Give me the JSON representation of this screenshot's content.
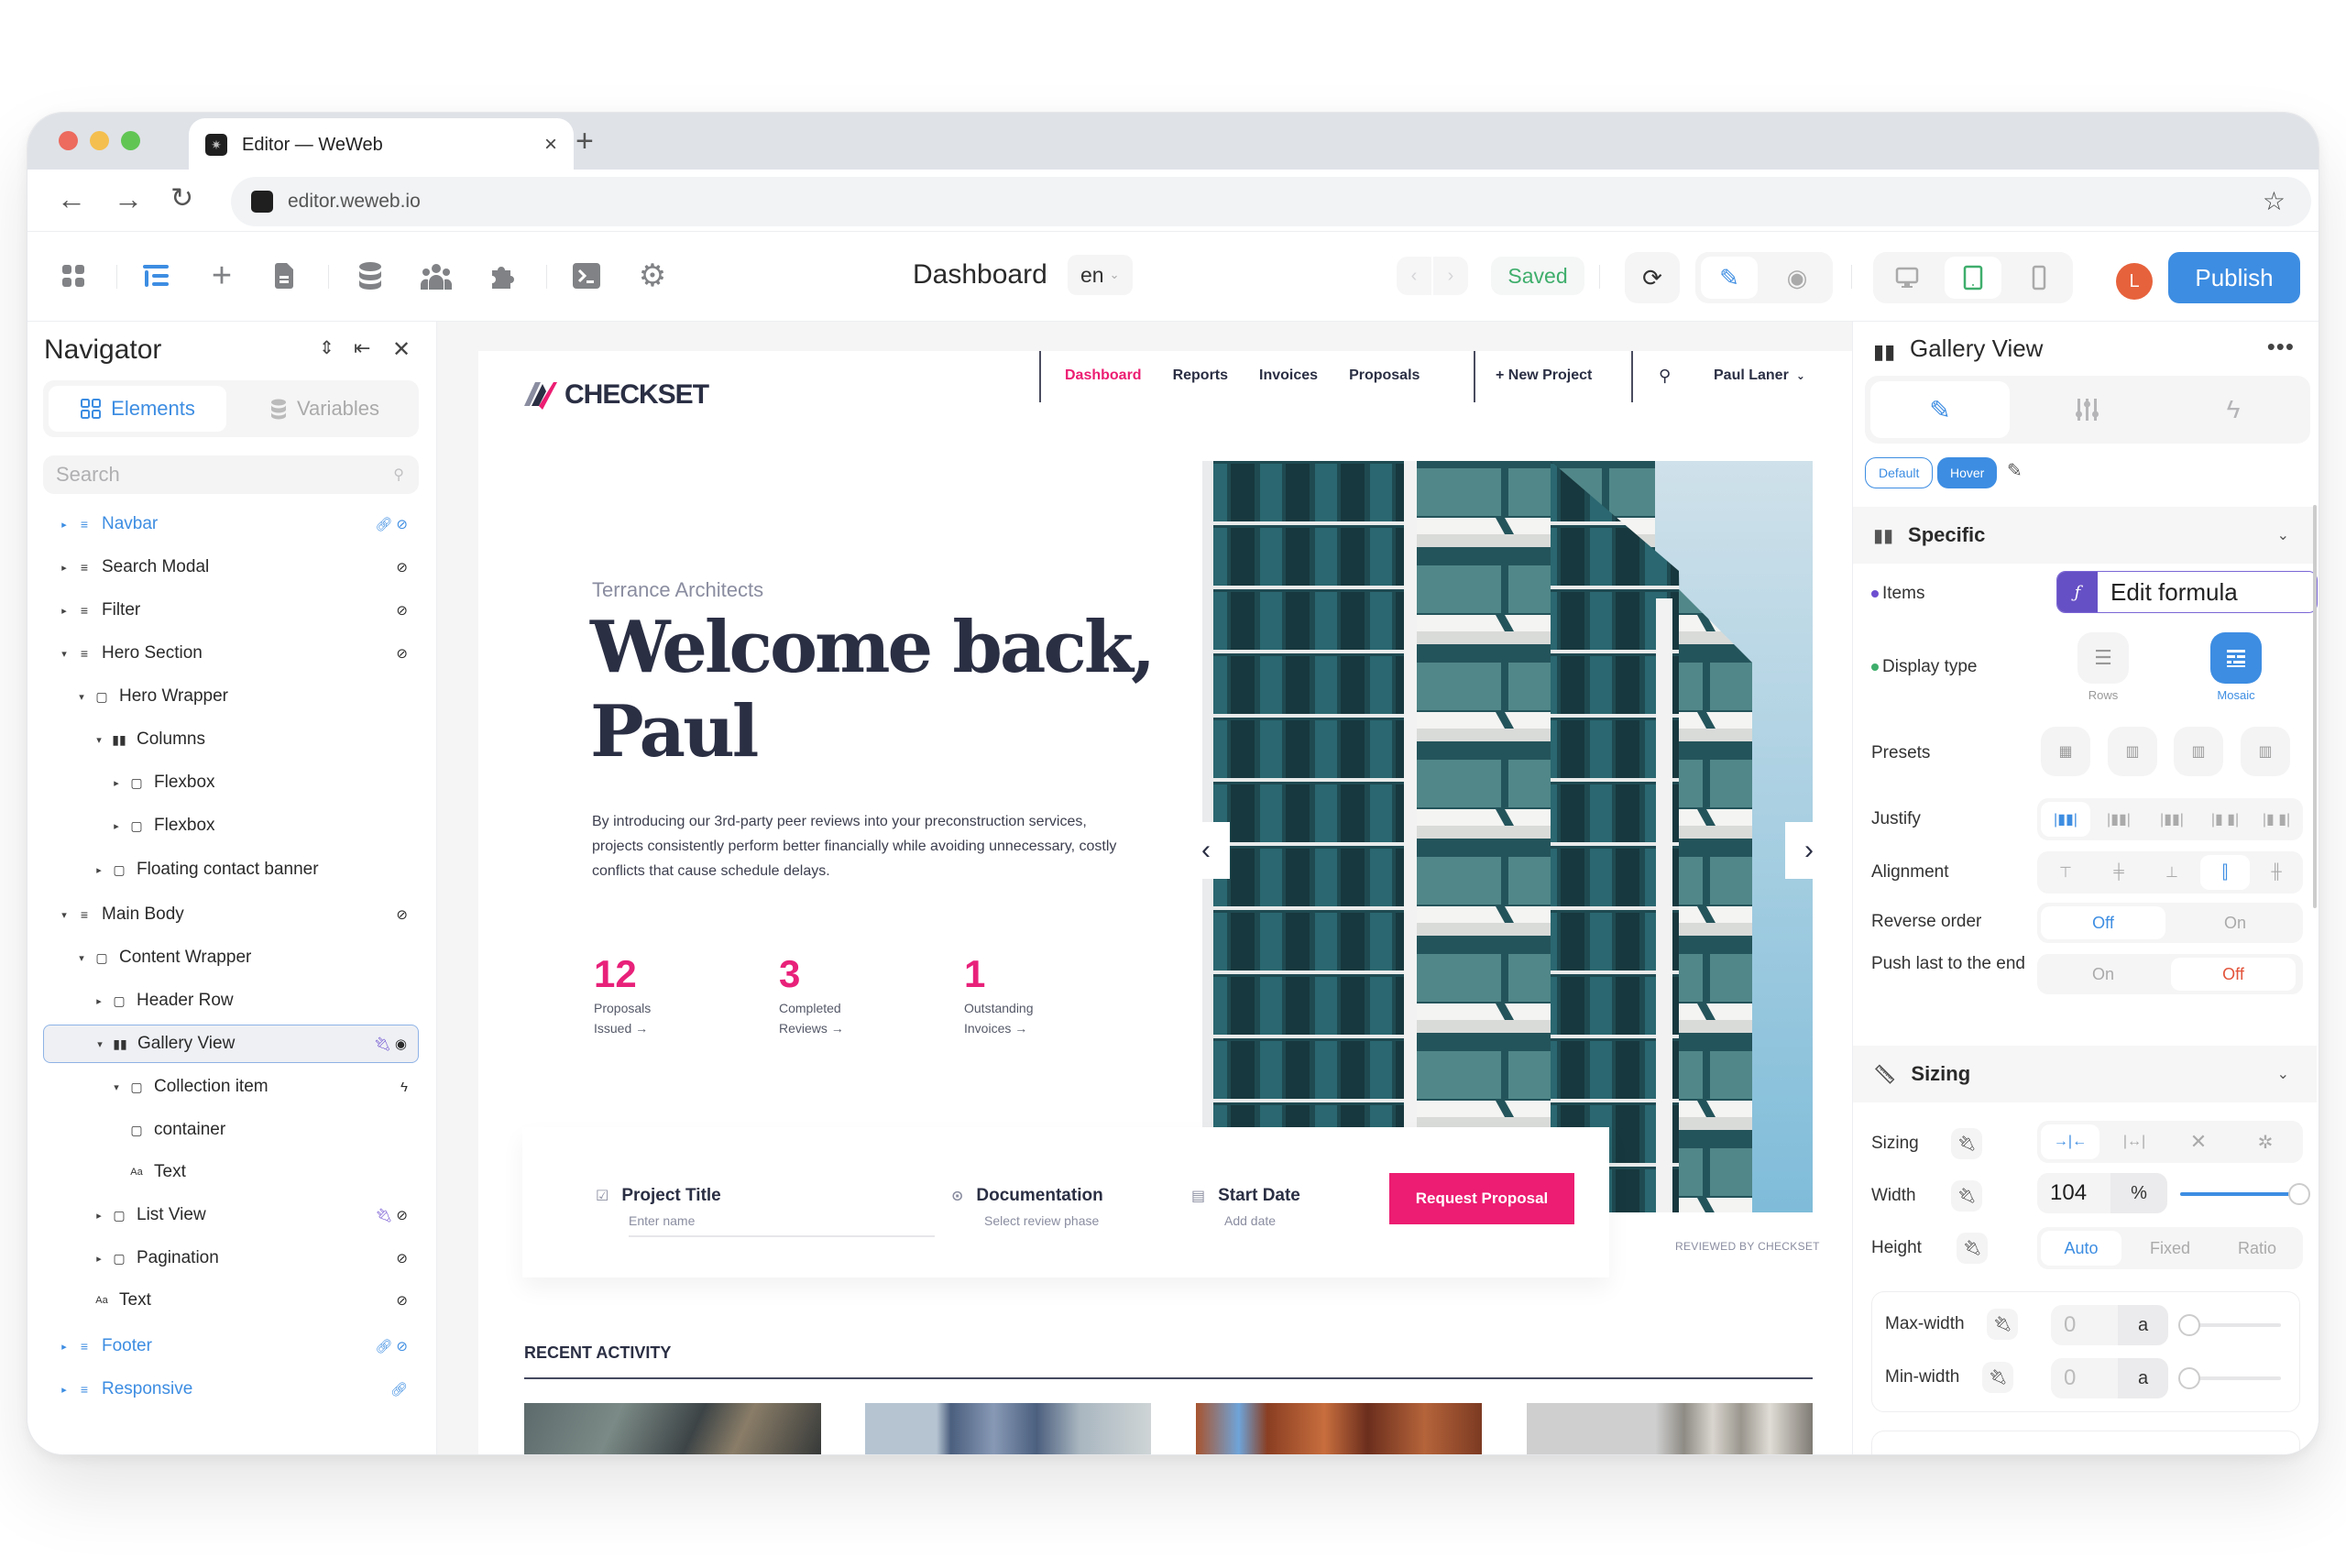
{
  "browser": {
    "tab_title": "Editor — WeWeb",
    "url": "editor.weweb.io",
    "traffic_lights": {
      "close": "#ec6a5e",
      "minimize": "#f4bf4f",
      "zoom": "#61c554"
    }
  },
  "toolbar": {
    "left_icons": [
      "apps-icon",
      "navigator-icon",
      "add-icon",
      "pages-icon",
      "data-icon",
      "users-icon",
      "plugins-icon",
      "console-icon",
      "settings-icon"
    ],
    "page_title": "Dashboard",
    "language": "en",
    "save_status": "Saved",
    "publish_label": "Publish",
    "avatar_initial": "L",
    "colors": {
      "accent": "#3d8de2",
      "saved": "#3fae6c",
      "avatar": "#e6623c"
    }
  },
  "navigator": {
    "title": "Navigator",
    "tabs": [
      {
        "label": "Elements",
        "active": true
      },
      {
        "label": "Variables",
        "active": false
      }
    ],
    "search_placeholder": "Search",
    "tree": [
      {
        "label": "Navbar",
        "depth": 0,
        "icon": "section",
        "caret": "right",
        "badges": [
          "link",
          "hidden"
        ],
        "linked": true
      },
      {
        "label": "Search Modal",
        "depth": 0,
        "icon": "section",
        "caret": "right",
        "badges": [
          "hidden"
        ]
      },
      {
        "label": "Filter",
        "depth": 0,
        "icon": "section",
        "caret": "right",
        "badges": [
          "hidden"
        ]
      },
      {
        "label": "Hero Section",
        "depth": 0,
        "icon": "section",
        "caret": "down",
        "badges": [
          "hidden"
        ]
      },
      {
        "label": "Hero Wrapper",
        "depth": 1,
        "icon": "box",
        "caret": "down",
        "badges": []
      },
      {
        "label": "Columns",
        "depth": 2,
        "icon": "columns",
        "caret": "down",
        "badges": []
      },
      {
        "label": "Flexbox",
        "depth": 3,
        "icon": "box",
        "caret": "right",
        "badges": []
      },
      {
        "label": "Flexbox",
        "depth": 3,
        "icon": "box",
        "caret": "right",
        "badges": []
      },
      {
        "label": "Floating contact banner",
        "depth": 2,
        "icon": "box",
        "caret": "right",
        "badges": []
      },
      {
        "label": "Main Body",
        "depth": 0,
        "icon": "section",
        "caret": "down",
        "badges": [
          "hidden"
        ]
      },
      {
        "label": "Content Wrapper",
        "depth": 1,
        "icon": "box",
        "caret": "down",
        "badges": []
      },
      {
        "label": "Header Row",
        "depth": 2,
        "icon": "box",
        "caret": "right",
        "badges": []
      },
      {
        "label": "Gallery View",
        "depth": 2,
        "icon": "columns",
        "caret": "down",
        "badges": [
          "bound",
          "visible"
        ],
        "selected": true
      },
      {
        "label": "Collection item",
        "depth": 3,
        "icon": "box",
        "caret": "down",
        "badges": [
          "workflow"
        ]
      },
      {
        "label": "container",
        "depth": 3,
        "icon": "box",
        "caret": "none",
        "badges": []
      },
      {
        "label": "Text",
        "depth": 3,
        "icon": "text",
        "caret": "none",
        "badges": []
      },
      {
        "label": "List View",
        "depth": 2,
        "icon": "box",
        "caret": "right",
        "badges": [
          "bound",
          "hidden"
        ]
      },
      {
        "label": "Pagination",
        "depth": 2,
        "icon": "box",
        "caret": "right",
        "badges": [
          "hidden"
        ]
      },
      {
        "label": "Text",
        "depth": 1,
        "icon": "text",
        "caret": "none",
        "badges": [
          "hidden"
        ]
      },
      {
        "label": "Footer",
        "depth": 0,
        "icon": "section",
        "caret": "right",
        "badges": [
          "link",
          "hidden"
        ],
        "linked": true
      },
      {
        "label": "Responsive",
        "depth": 0,
        "icon": "section",
        "caret": "right",
        "badges": [
          "link"
        ],
        "linked": true
      }
    ]
  },
  "site": {
    "brand": "CHECKSET",
    "nav": [
      {
        "label": "Dashboard",
        "active": true
      },
      {
        "label": "Reports"
      },
      {
        "label": "Invoices"
      },
      {
        "label": "Proposals"
      }
    ],
    "new_project": "+ New Project",
    "user_menu": "Paul Laner",
    "kicker": "Terrance Architects",
    "headline": "Welcome back, Paul",
    "intro": "By introducing our 3rd-party peer reviews into your preconstruction services, projects consistently perform better financially while avoiding unnecessary, costly conflicts that cause schedule delays.",
    "stats": [
      {
        "value": "12",
        "line1": "Proposals",
        "line2": "Issued →"
      },
      {
        "value": "3",
        "line1": "Completed",
        "line2": "Reviews →"
      },
      {
        "value": "1",
        "line1": "Outstanding",
        "line2": "Invoices →"
      }
    ],
    "form": {
      "fields": [
        {
          "title": "Project Title",
          "placeholder": "Enter name"
        },
        {
          "title": "Documentation",
          "placeholder": "Select review phase"
        },
        {
          "title": "Start Date",
          "placeholder": "Add date"
        }
      ],
      "submit": "Request Proposal"
    },
    "image_caption": "REVIEWED BY CHECKSET",
    "recent_title": "RECENT ACTIVITY",
    "brand_color": "#ec1d72",
    "ink_color": "#2b2f44"
  },
  "inspector": {
    "element_title": "Gallery View",
    "state_chips": [
      {
        "label": "Default",
        "active": false
      },
      {
        "label": "Hover",
        "active": true
      }
    ],
    "sections": {
      "specific": "Specific",
      "sizing": "Sizing"
    },
    "props": {
      "items_label": "Items",
      "items_value": "Edit formula",
      "display_type_label": "Display type",
      "display_options": [
        {
          "label": "Rows",
          "active": false
        },
        {
          "label": "Mosaic",
          "active": true
        }
      ],
      "presets_label": "Presets",
      "justify_label": "Justify",
      "justify_active_index": 0,
      "alignment_label": "Alignment",
      "alignment_active_index": 3,
      "reverse_label": "Reverse order",
      "reverse_options": [
        {
          "label": "Off",
          "active": true
        },
        {
          "label": "On",
          "active": false
        }
      ],
      "push_label": "Push last to the end",
      "push_options": [
        {
          "label": "On",
          "active": false
        },
        {
          "label": "Off",
          "active": true
        }
      ],
      "sizing_label": "Sizing",
      "width_label": "Width",
      "width_value": "104",
      "width_unit": "%",
      "width_slider_fraction": 1.0,
      "height_label": "Height",
      "height_options": [
        {
          "label": "Auto",
          "active": true
        },
        {
          "label": "Fixed",
          "active": false
        },
        {
          "label": "Ratio",
          "active": false
        }
      ],
      "max_width_label": "Max-width",
      "max_width_value": "0",
      "max_width_unit": "a",
      "min_width_label": "Min-width",
      "min_width_value": "0",
      "min_width_unit": "a"
    }
  }
}
